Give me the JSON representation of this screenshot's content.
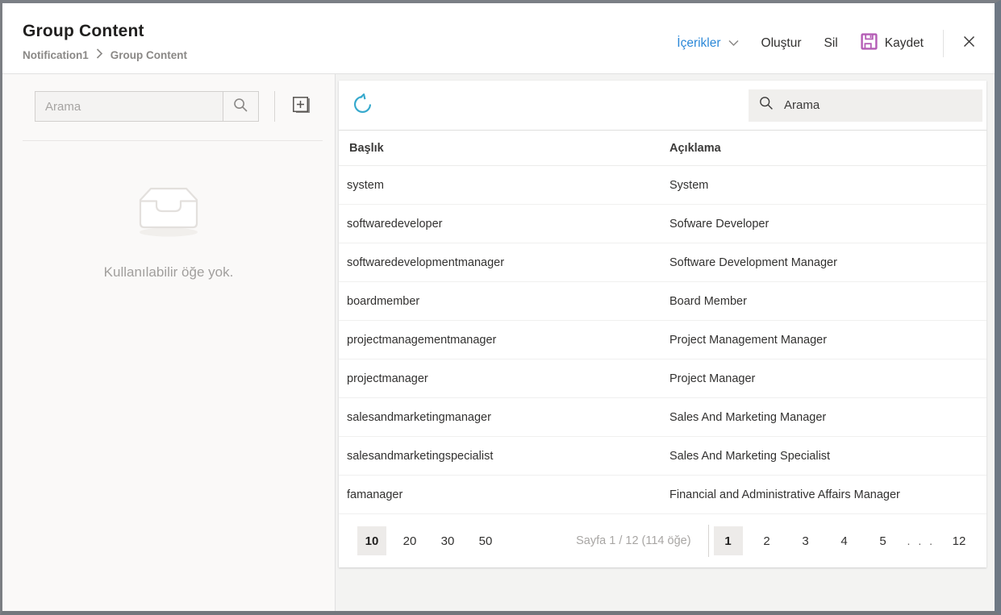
{
  "colors": {
    "accent_blue": "#2b88d8",
    "save_icon_purple": "#b45cb5",
    "refresh_icon_blue": "#36a9cd"
  },
  "icons": {
    "breadcrumb_separator": "chevron-right",
    "contents_dropdown": "chevron-down",
    "save": "floppy-disk",
    "close": "x-mark",
    "left_search": "magnifier",
    "add": "add-square",
    "empty_state": "inbox-tray",
    "refresh": "circular-arrow",
    "right_search": "magnifier"
  },
  "header": {
    "title": "Group Content",
    "breadcrumb": {
      "parent": "Notification1",
      "current": "Group Content"
    },
    "actions": {
      "contents": "İçerikler",
      "create": "Oluştur",
      "delete": "Sil",
      "save": "Kaydet"
    }
  },
  "left_panel": {
    "search_placeholder": "Arama",
    "empty_message": "Kullanılabilir öğe yok."
  },
  "content": {
    "search_placeholder": "Arama",
    "columns": {
      "title": "Başlık",
      "description": "Açıklama"
    },
    "rows": [
      {
        "title": "system",
        "description": "System"
      },
      {
        "title": "softwaredeveloper",
        "description": "Sofware Developer"
      },
      {
        "title": "softwaredevelopmentmanager",
        "description": "Software Development Manager"
      },
      {
        "title": "boardmember",
        "description": "Board Member"
      },
      {
        "title": "projectmanagementmanager",
        "description": "Project Management Manager"
      },
      {
        "title": "projectmanager",
        "description": "Project Manager"
      },
      {
        "title": "salesandmarketingmanager",
        "description": "Sales And Marketing Manager"
      },
      {
        "title": "salesandmarketingspecialist",
        "description": "Sales And Marketing Specialist"
      },
      {
        "title": "famanager",
        "description": "Financial and Administrative Affairs Manager"
      }
    ],
    "pagination": {
      "page_sizes": [
        "10",
        "20",
        "30",
        "50"
      ],
      "active_page_size": "10",
      "info": "Sayfa 1 / 12 (114 öğe)",
      "pages": [
        "1",
        "2",
        "3",
        "4",
        "5"
      ],
      "ellipsis": ". . .",
      "last_page": "12",
      "active_page": "1"
    }
  }
}
